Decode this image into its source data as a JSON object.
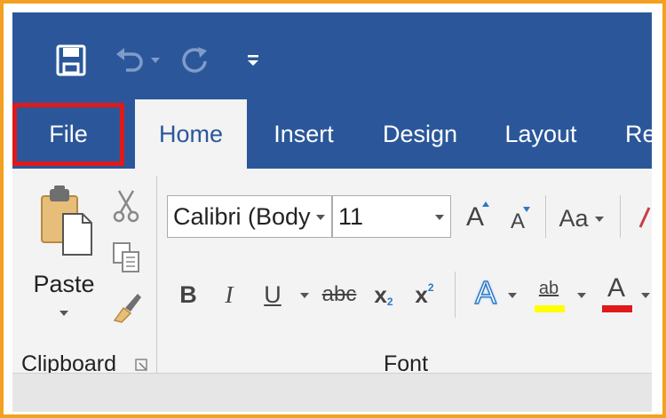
{
  "quick_access": {
    "icons": [
      "save-icon",
      "undo-icon",
      "undo-dropdown-icon",
      "redo-icon",
      "customize-qat-icon"
    ]
  },
  "tabs": [
    {
      "label": "File"
    },
    {
      "label": "Home"
    },
    {
      "label": "Insert"
    },
    {
      "label": "Design"
    },
    {
      "label": "Layout"
    },
    {
      "label": "Re"
    }
  ],
  "active_tab": "Home",
  "highlight": {
    "target": "File",
    "color": "#e0191b"
  },
  "colors": {
    "ribbon_blue": "#2b579a",
    "frame_orange": "#f4a020",
    "highlight_yellow": "#ffff00",
    "font_red": "#e0191b"
  },
  "clipboard": {
    "paste_label": "Paste",
    "group_label": "Clipboard"
  },
  "font": {
    "font_name": "Calibri (Body",
    "font_size": "11",
    "change_case_label": "Aa",
    "bold_label": "B",
    "italic_label": "I",
    "underline_label": "U",
    "strike_label": "abc",
    "subscript_label": "x",
    "subscript_mark": "2",
    "superscript_label": "x",
    "superscript_mark": "2",
    "text_effects_label": "A",
    "highlight_label": "ab",
    "font_color_label": "A",
    "grow_label": "A",
    "shrink_label": "A",
    "group_label": "Font"
  }
}
